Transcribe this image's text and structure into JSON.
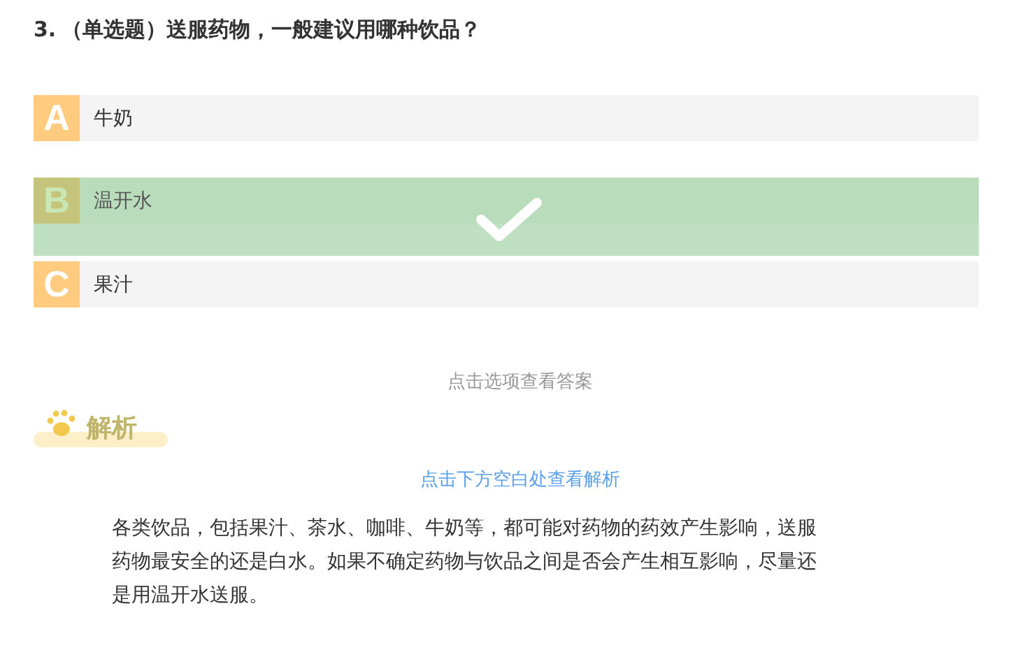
{
  "question": {
    "number": "3.",
    "text": "（单选题）送服药物，一般建议用哪种饮品？"
  },
  "options": [
    {
      "letter": "A",
      "text": "牛奶",
      "selected": false
    },
    {
      "letter": "B",
      "text": "温开水",
      "selected": true
    },
    {
      "letter": "C",
      "text": "果汁",
      "selected": false
    }
  ],
  "answer_hint": "点击选项查看答案",
  "analysis": {
    "heading": "解析",
    "reveal_link": "点击下方空白处查看解析",
    "body": "各类饮品，包括果汁、茶水、咖啡、牛奶等，都可能对药物的药效产生影响，送服药物最安全的还是白水。如果不确定药物与饮品之间是否会产生相互影响，尽量还是用温开水送服。"
  }
}
